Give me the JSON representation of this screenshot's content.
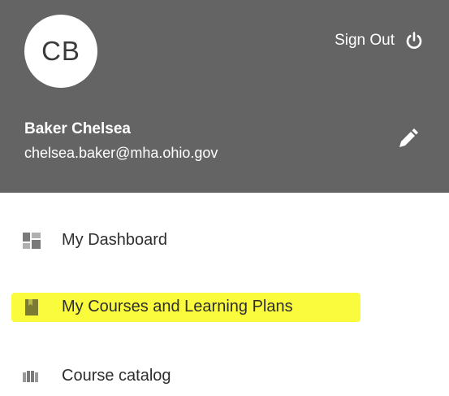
{
  "user": {
    "initials": "CB",
    "name": "Baker Chelsea",
    "email": "chelsea.baker@mha.ohio.gov"
  },
  "header": {
    "signout_label": "Sign Out",
    "signout_icon": "power-icon",
    "edit_icon": "pencil-icon",
    "background_color": "#646464"
  },
  "nav": {
    "items": [
      {
        "label": "My Dashboard",
        "icon": "dashboard-grid-icon",
        "highlighted": false
      },
      {
        "label": "My Courses and Learning Plans",
        "icon": "book-icon",
        "highlighted": true
      },
      {
        "label": "Course catalog",
        "icon": "catalog-books-icon",
        "highlighted": false
      }
    ],
    "highlight_color": "#fbfb3d"
  }
}
